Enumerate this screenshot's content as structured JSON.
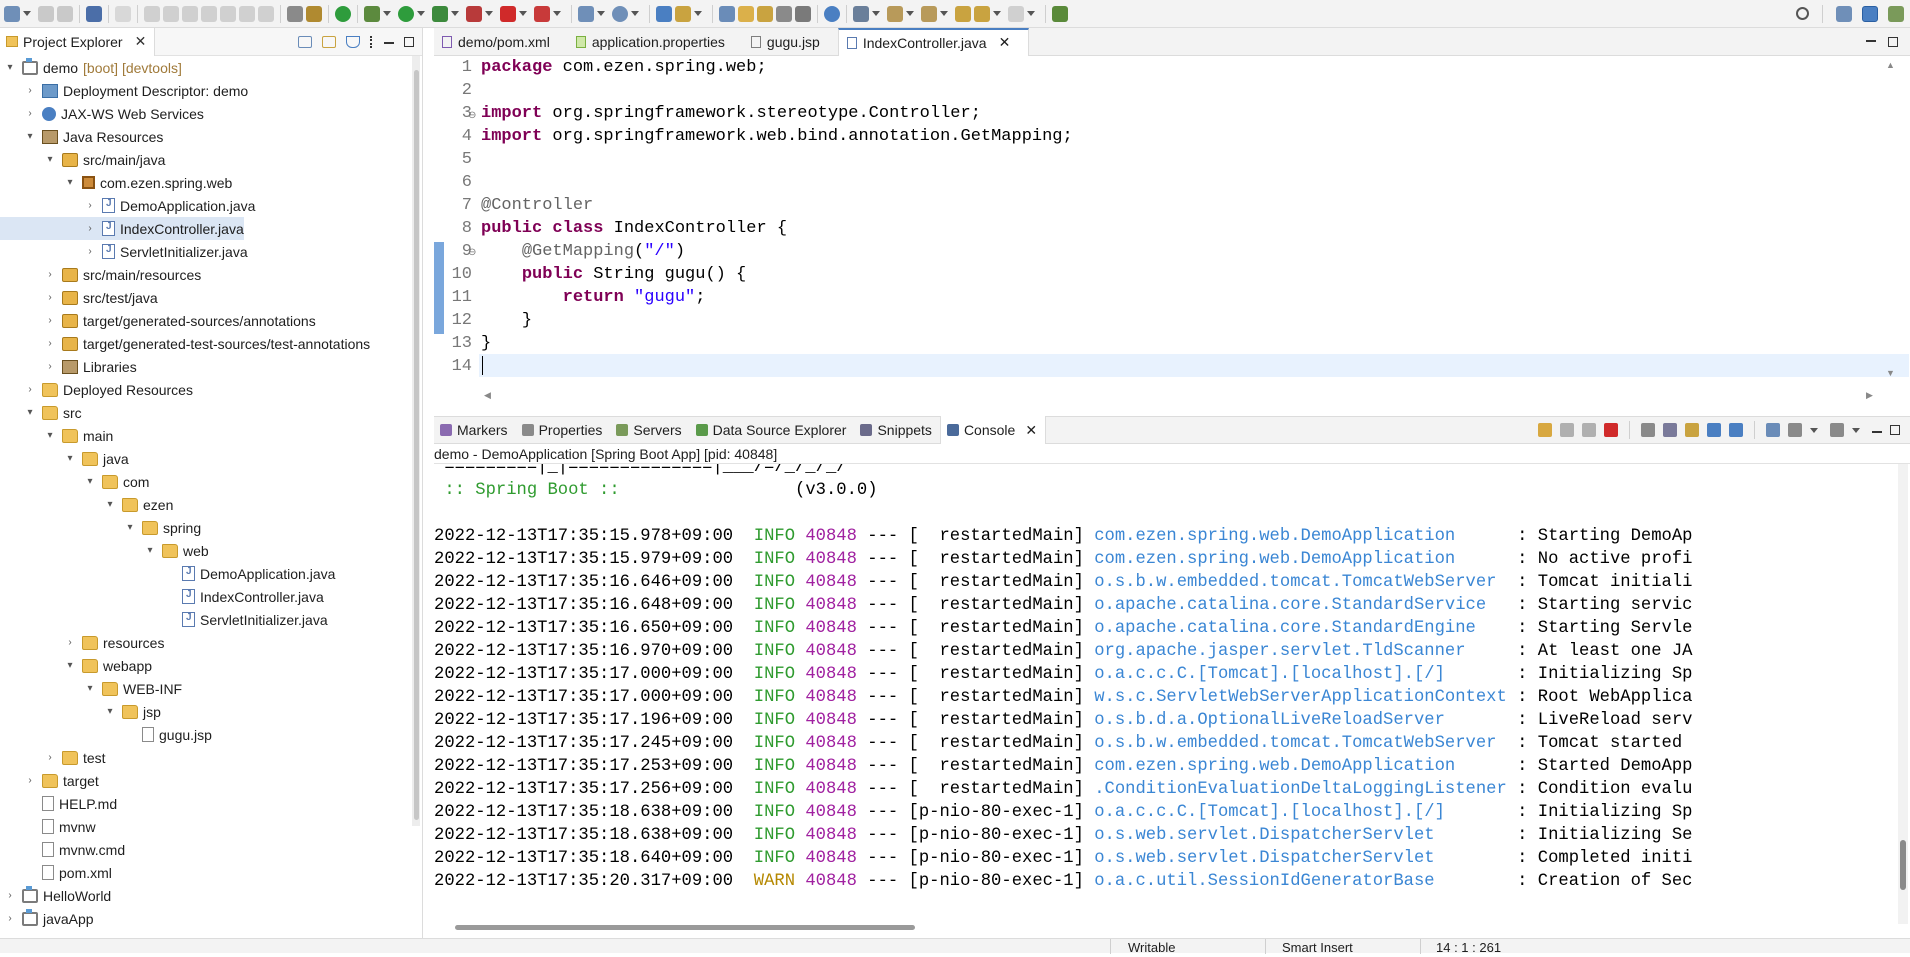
{
  "explorer": {
    "tab_label": "Project Explorer",
    "tree": [
      {
        "label": "demo",
        "suffix": "[boot] [devtools]"
      },
      {
        "label": "Deployment Descriptor: demo"
      },
      {
        "label": "JAX-WS Web Services"
      },
      {
        "label": "Java Resources"
      },
      {
        "label": "src/main/java"
      },
      {
        "label": "com.ezen.spring.web"
      },
      {
        "label": "DemoApplication.java"
      },
      {
        "label": "IndexController.java"
      },
      {
        "label": "ServletInitializer.java"
      },
      {
        "label": "src/main/resources"
      },
      {
        "label": "src/test/java"
      },
      {
        "label": "target/generated-sources/annotations"
      },
      {
        "label": "target/generated-test-sources/test-annotations"
      },
      {
        "label": "Libraries"
      },
      {
        "label": "Deployed Resources"
      },
      {
        "label": "src"
      },
      {
        "label": "main"
      },
      {
        "label": "java"
      },
      {
        "label": "com"
      },
      {
        "label": "ezen"
      },
      {
        "label": "spring"
      },
      {
        "label": "web"
      },
      {
        "label": "DemoApplication.java"
      },
      {
        "label": "IndexController.java"
      },
      {
        "label": "ServletInitializer.java"
      },
      {
        "label": "resources"
      },
      {
        "label": "webapp"
      },
      {
        "label": "WEB-INF"
      },
      {
        "label": "jsp"
      },
      {
        "label": "gugu.jsp"
      },
      {
        "label": "test"
      },
      {
        "label": "target"
      },
      {
        "label": "HELP.md"
      },
      {
        "label": "mvnw"
      },
      {
        "label": "mvnw.cmd"
      },
      {
        "label": "pom.xml"
      },
      {
        "label": "HelloWorld"
      },
      {
        "label": "javaApp"
      }
    ]
  },
  "editor": {
    "tabs": [
      {
        "label": "demo/pom.xml"
      },
      {
        "label": "application.properties"
      },
      {
        "label": "gugu.jsp"
      },
      {
        "label": "IndexController.java"
      }
    ],
    "line_numbers": [
      "1",
      "2",
      "3",
      "4",
      "5",
      "6",
      "7",
      "8",
      "9",
      "10",
      "11",
      "12",
      "13",
      "14"
    ],
    "code": {
      "l1_kw": "package",
      "l1_rest": " com.ezen.spring.web;",
      "l3_kw": "import",
      "l3_rest": " org.springframework.stereotype.Controller;",
      "l4_kw": "import",
      "l4_rest": " org.springframework.web.bind.annotation.GetMapping;",
      "l7_ann": "@Controller",
      "l8_kw1": "public",
      "l8_kw2": "class",
      "l8_rest": " IndexController {",
      "l9_ann": "@GetMapping",
      "l9_p1": "(",
      "l9_str": "\"/\"",
      "l9_p2": ")",
      "l10_kw": "public",
      "l10_rest": " String gugu() {",
      "l11_kw": "return",
      "l11_str": "\"gugu\"",
      "l11_rest": ";",
      "l12": "}",
      "l13": "}"
    }
  },
  "console": {
    "tabs": [
      {
        "label": "Markers"
      },
      {
        "label": "Properties"
      },
      {
        "label": "Servers"
      },
      {
        "label": "Data Source Explorer"
      },
      {
        "label": "Snippets"
      },
      {
        "label": "Console"
      }
    ],
    "title": "demo - DemoApplication [Spring Boot App]  [pid: 40848]",
    "banner_line": " =========|_|==============|___/=/_/_/_/",
    "banner_boot": " :: Spring Boot ::",
    "banner_version": "(v3.0.0)",
    "logs": [
      {
        "ts": "2022-12-13T17:35:15.978+09:00",
        "level": "INFO",
        "pid": "40848",
        "thread": "[  restartedMain]",
        "logger": "com.ezen.spring.web.DemoApplication",
        "msg": ": Starting DemoAp"
      },
      {
        "ts": "2022-12-13T17:35:15.979+09:00",
        "level": "INFO",
        "pid": "40848",
        "thread": "[  restartedMain]",
        "logger": "com.ezen.spring.web.DemoApplication",
        "msg": ": No active profi"
      },
      {
        "ts": "2022-12-13T17:35:16.646+09:00",
        "level": "INFO",
        "pid": "40848",
        "thread": "[  restartedMain]",
        "logger": "o.s.b.w.embedded.tomcat.TomcatWebServer",
        "msg": ": Tomcat initiali"
      },
      {
        "ts": "2022-12-13T17:35:16.648+09:00",
        "level": "INFO",
        "pid": "40848",
        "thread": "[  restartedMain]",
        "logger": "o.apache.catalina.core.StandardService",
        "msg": ": Starting servic"
      },
      {
        "ts": "2022-12-13T17:35:16.650+09:00",
        "level": "INFO",
        "pid": "40848",
        "thread": "[  restartedMain]",
        "logger": "o.apache.catalina.core.StandardEngine",
        "msg": ": Starting Servle"
      },
      {
        "ts": "2022-12-13T17:35:16.970+09:00",
        "level": "INFO",
        "pid": "40848",
        "thread": "[  restartedMain]",
        "logger": "org.apache.jasper.servlet.TldScanner",
        "msg": ": At least one JA"
      },
      {
        "ts": "2022-12-13T17:35:17.000+09:00",
        "level": "INFO",
        "pid": "40848",
        "thread": "[  restartedMain]",
        "logger": "o.a.c.c.C.[Tomcat].[localhost].[/]",
        "msg": ": Initializing Sp"
      },
      {
        "ts": "2022-12-13T17:35:17.000+09:00",
        "level": "INFO",
        "pid": "40848",
        "thread": "[  restartedMain]",
        "logger": "w.s.c.ServletWebServerApplicationContext",
        "msg": ": Root WebApplica"
      },
      {
        "ts": "2022-12-13T17:35:17.196+09:00",
        "level": "INFO",
        "pid": "40848",
        "thread": "[  restartedMain]",
        "logger": "o.s.b.d.a.OptionalLiveReloadServer",
        "msg": ": LiveReload serv"
      },
      {
        "ts": "2022-12-13T17:35:17.245+09:00",
        "level": "INFO",
        "pid": "40848",
        "thread": "[  restartedMain]",
        "logger": "o.s.b.w.embedded.tomcat.TomcatWebServer",
        "msg": ": Tomcat started"
      },
      {
        "ts": "2022-12-13T17:35:17.253+09:00",
        "level": "INFO",
        "pid": "40848",
        "thread": "[  restartedMain]",
        "logger": "com.ezen.spring.web.DemoApplication",
        "msg": ": Started DemoApp"
      },
      {
        "ts": "2022-12-13T17:35:17.256+09:00",
        "level": "INFO",
        "pid": "40848",
        "thread": "[  restartedMain]",
        "logger": ".ConditionEvaluationDeltaLoggingListener",
        "msg": ": Condition evalu"
      },
      {
        "ts": "2022-12-13T17:35:18.638+09:00",
        "level": "INFO",
        "pid": "40848",
        "thread": "[p-nio-80-exec-1]",
        "logger": "o.a.c.c.C.[Tomcat].[localhost].[/]",
        "msg": ": Initializing Sp"
      },
      {
        "ts": "2022-12-13T17:35:18.638+09:00",
        "level": "INFO",
        "pid": "40848",
        "thread": "[p-nio-80-exec-1]",
        "logger": "o.s.web.servlet.DispatcherServlet",
        "msg": ": Initializing Se"
      },
      {
        "ts": "2022-12-13T17:35:18.640+09:00",
        "level": "INFO",
        "pid": "40848",
        "thread": "[p-nio-80-exec-1]",
        "logger": "o.s.web.servlet.DispatcherServlet",
        "msg": ": Completed initi"
      },
      {
        "ts": "2022-12-13T17:35:20.317+09:00",
        "level": "WARN",
        "pid": "40848",
        "thread": "[p-nio-80-exec-1]",
        "logger": "o.a.c.util.SessionIdGeneratorBase",
        "msg": ": Creation of Sec"
      }
    ],
    "separator": "---"
  },
  "status": {
    "writable": "Writable",
    "insert_mode": "Smart Insert",
    "position": "14 : 1 : 261"
  },
  "colors": {
    "keyword": "#7f0055",
    "string": "#2a00ff",
    "annotation": "#646464",
    "info": "#2f9b2f",
    "warn": "#b58800",
    "pid": "#a020a0",
    "logger": "#3a86d4"
  }
}
